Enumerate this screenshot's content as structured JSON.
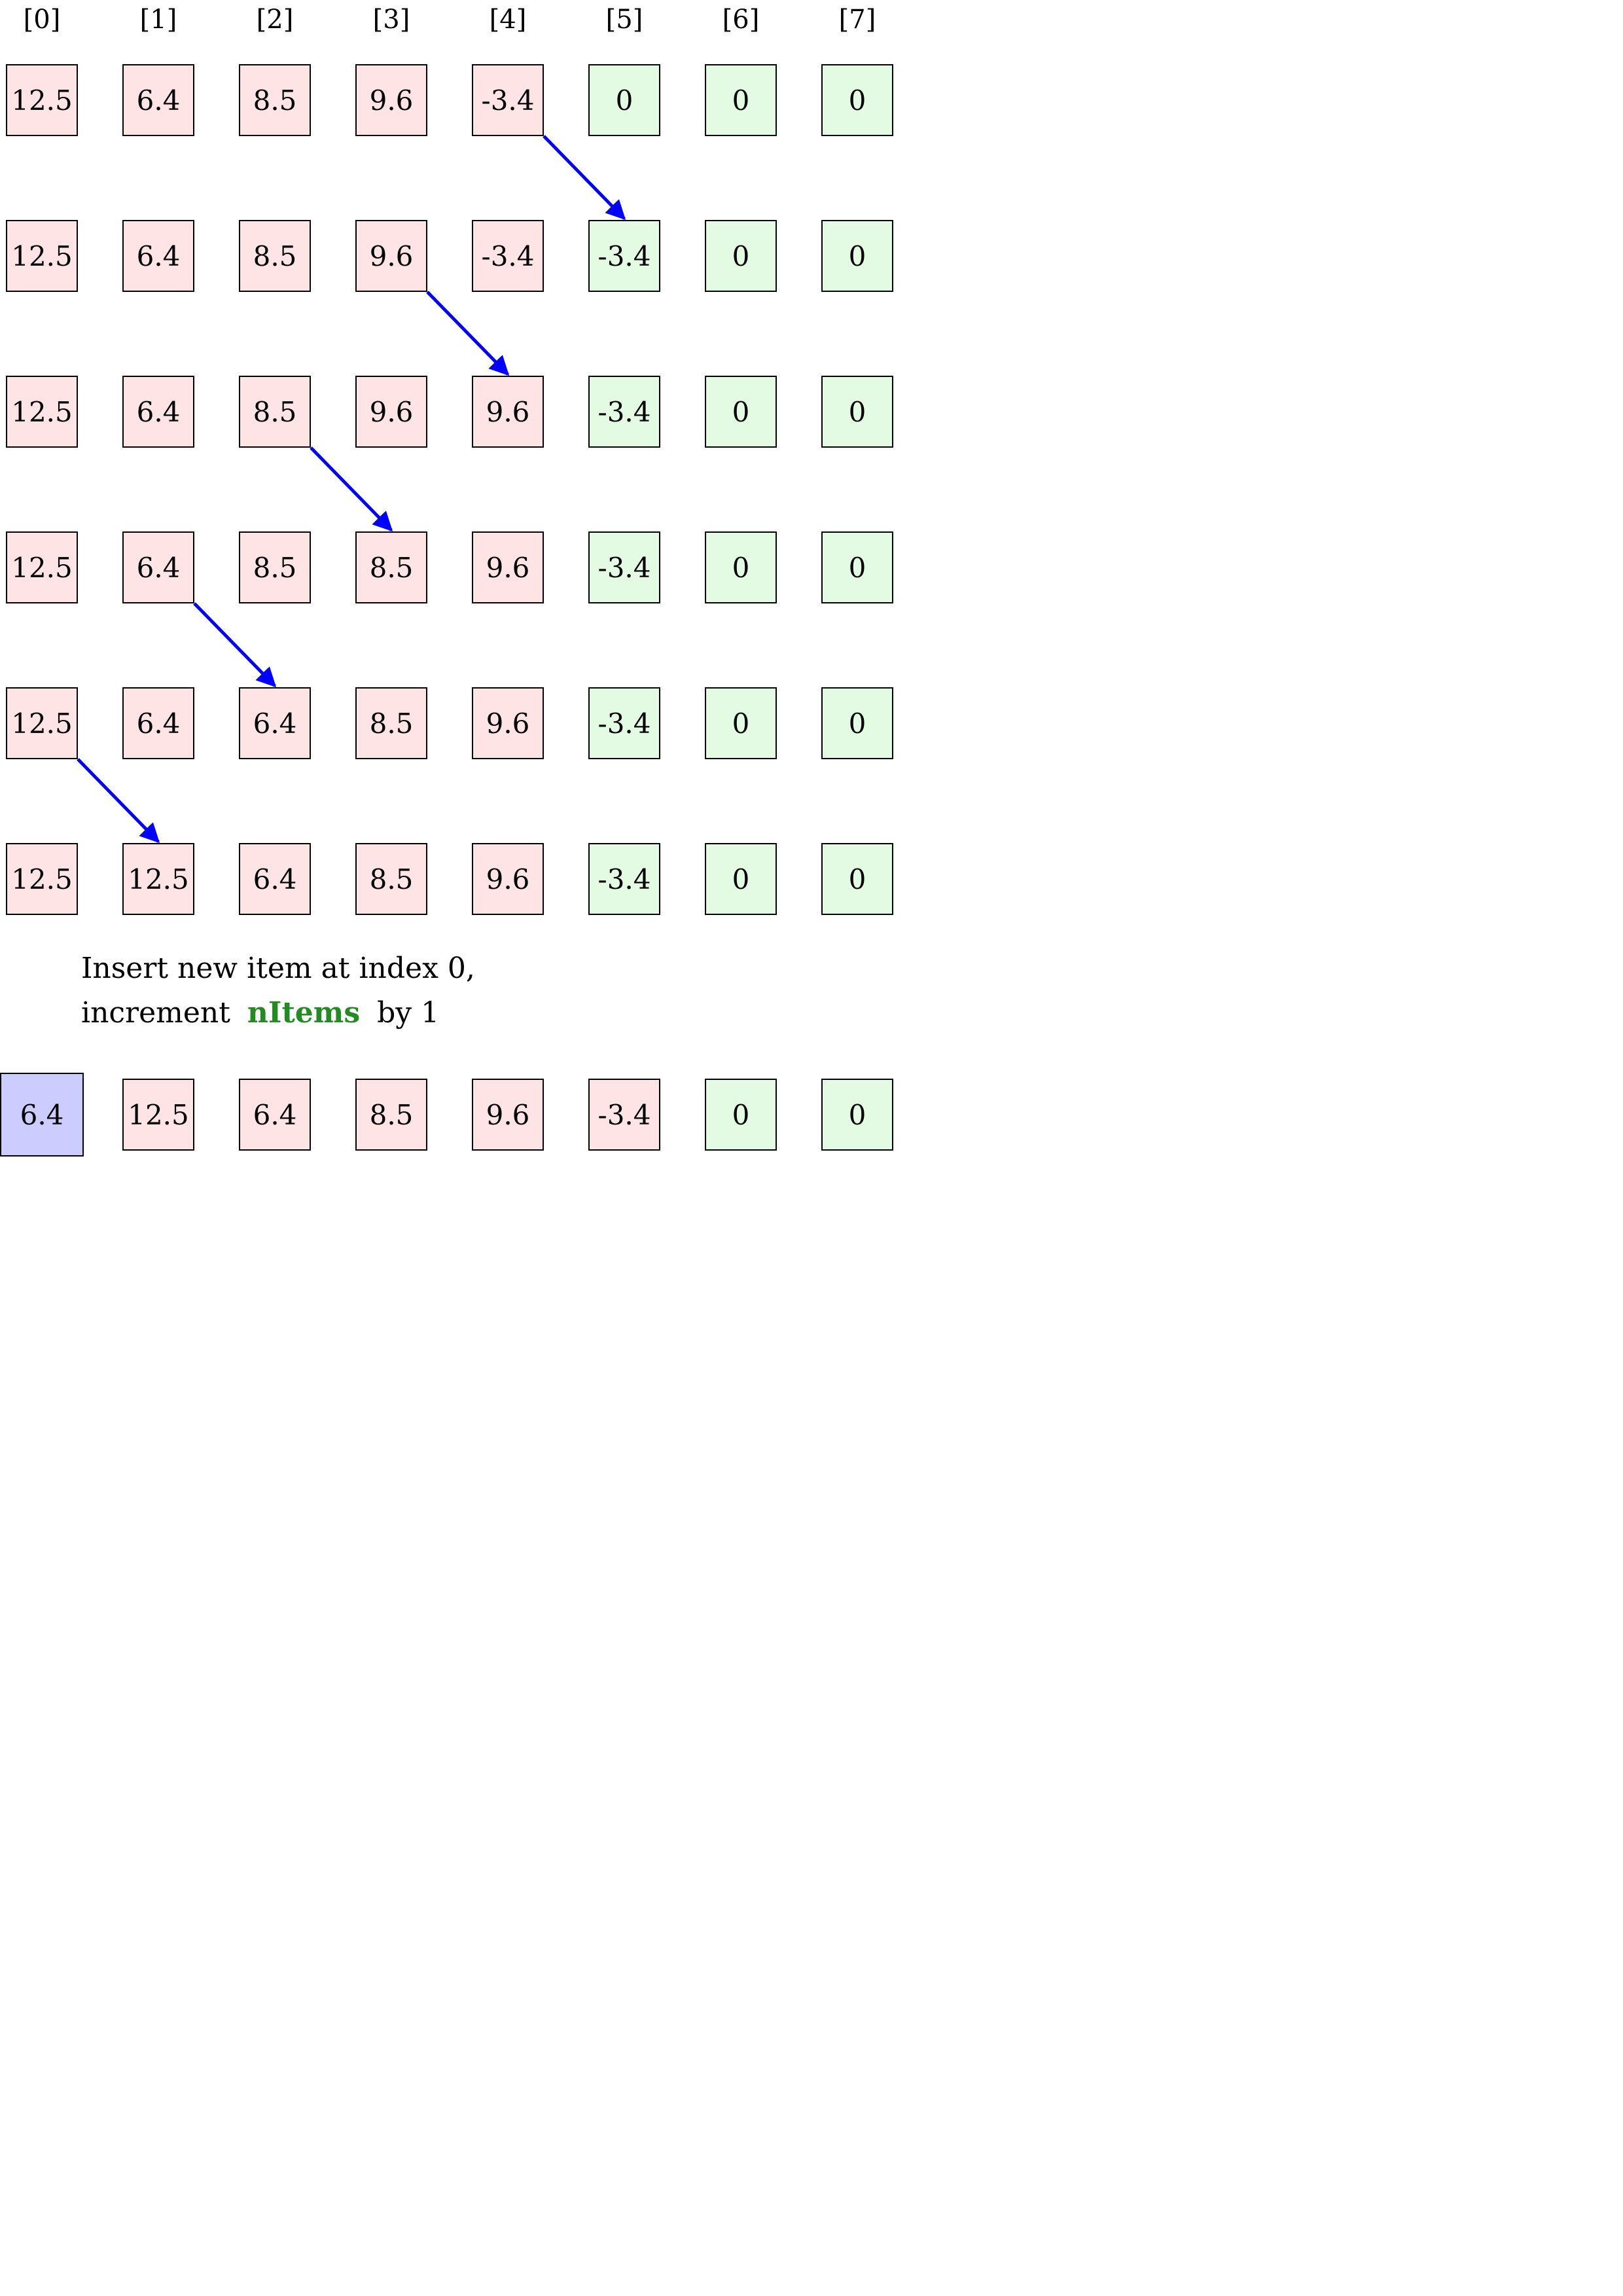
{
  "colors": {
    "unsorted": "#ffe4e6",
    "empty": "#e2fbe2",
    "inserted": "#ccccff",
    "border": "#000000",
    "arrow": "#0000ff",
    "keyword": "#228b22"
  },
  "indices": [
    "[0]",
    "[1]",
    "[2]",
    "[3]",
    "[4]",
    "[5]",
    "[6]",
    "[7]"
  ],
  "rows": [
    {
      "cells": [
        {
          "value": "12.5",
          "kind": "unsorted"
        },
        {
          "value": "6.4",
          "kind": "unsorted"
        },
        {
          "value": "8.5",
          "kind": "unsorted"
        },
        {
          "value": "9.6",
          "kind": "unsorted"
        },
        {
          "value": "-3.4",
          "kind": "unsorted"
        },
        {
          "value": "0",
          "kind": "empty"
        },
        {
          "value": "0",
          "kind": "empty"
        },
        {
          "value": "0",
          "kind": "empty"
        }
      ],
      "shift": {
        "from": 4,
        "to": 5
      }
    },
    {
      "cells": [
        {
          "value": "12.5",
          "kind": "unsorted"
        },
        {
          "value": "6.4",
          "kind": "unsorted"
        },
        {
          "value": "8.5",
          "kind": "unsorted"
        },
        {
          "value": "9.6",
          "kind": "unsorted"
        },
        {
          "value": "-3.4",
          "kind": "unsorted"
        },
        {
          "value": "-3.4",
          "kind": "empty"
        },
        {
          "value": "0",
          "kind": "empty"
        },
        {
          "value": "0",
          "kind": "empty"
        }
      ],
      "shift": {
        "from": 3,
        "to": 4
      }
    },
    {
      "cells": [
        {
          "value": "12.5",
          "kind": "unsorted"
        },
        {
          "value": "6.4",
          "kind": "unsorted"
        },
        {
          "value": "8.5",
          "kind": "unsorted"
        },
        {
          "value": "9.6",
          "kind": "unsorted"
        },
        {
          "value": "9.6",
          "kind": "unsorted"
        },
        {
          "value": "-3.4",
          "kind": "empty"
        },
        {
          "value": "0",
          "kind": "empty"
        },
        {
          "value": "0",
          "kind": "empty"
        }
      ],
      "shift": {
        "from": 2,
        "to": 3
      }
    },
    {
      "cells": [
        {
          "value": "12.5",
          "kind": "unsorted"
        },
        {
          "value": "6.4",
          "kind": "unsorted"
        },
        {
          "value": "8.5",
          "kind": "unsorted"
        },
        {
          "value": "8.5",
          "kind": "unsorted"
        },
        {
          "value": "9.6",
          "kind": "unsorted"
        },
        {
          "value": "-3.4",
          "kind": "empty"
        },
        {
          "value": "0",
          "kind": "empty"
        },
        {
          "value": "0",
          "kind": "empty"
        }
      ],
      "shift": {
        "from": 1,
        "to": 2
      }
    },
    {
      "cells": [
        {
          "value": "12.5",
          "kind": "unsorted"
        },
        {
          "value": "6.4",
          "kind": "unsorted"
        },
        {
          "value": "6.4",
          "kind": "unsorted"
        },
        {
          "value": "8.5",
          "kind": "unsorted"
        },
        {
          "value": "9.6",
          "kind": "unsorted"
        },
        {
          "value": "-3.4",
          "kind": "empty"
        },
        {
          "value": "0",
          "kind": "empty"
        },
        {
          "value": "0",
          "kind": "empty"
        }
      ],
      "shift": {
        "from": 0,
        "to": 1
      }
    },
    {
      "cells": [
        {
          "value": "12.5",
          "kind": "unsorted"
        },
        {
          "value": "12.5",
          "kind": "unsorted"
        },
        {
          "value": "6.4",
          "kind": "unsorted"
        },
        {
          "value": "8.5",
          "kind": "unsorted"
        },
        {
          "value": "9.6",
          "kind": "unsorted"
        },
        {
          "value": "-3.4",
          "kind": "empty"
        },
        {
          "value": "0",
          "kind": "empty"
        },
        {
          "value": "0",
          "kind": "empty"
        }
      ]
    }
  ],
  "caption": {
    "line1": "Insert new item at index 0,",
    "line2_before": "increment",
    "keyword": "nItems",
    "line2_after": "by 1"
  },
  "final_row": {
    "cells": [
      {
        "value": "6.4",
        "kind": "inserted"
      },
      {
        "value": "12.5",
        "kind": "unsorted"
      },
      {
        "value": "6.4",
        "kind": "unsorted"
      },
      {
        "value": "8.5",
        "kind": "unsorted"
      },
      {
        "value": "9.6",
        "kind": "unsorted"
      },
      {
        "value": "-3.4",
        "kind": "unsorted"
      },
      {
        "value": "0",
        "kind": "empty"
      },
      {
        "value": "0",
        "kind": "empty"
      }
    ]
  }
}
